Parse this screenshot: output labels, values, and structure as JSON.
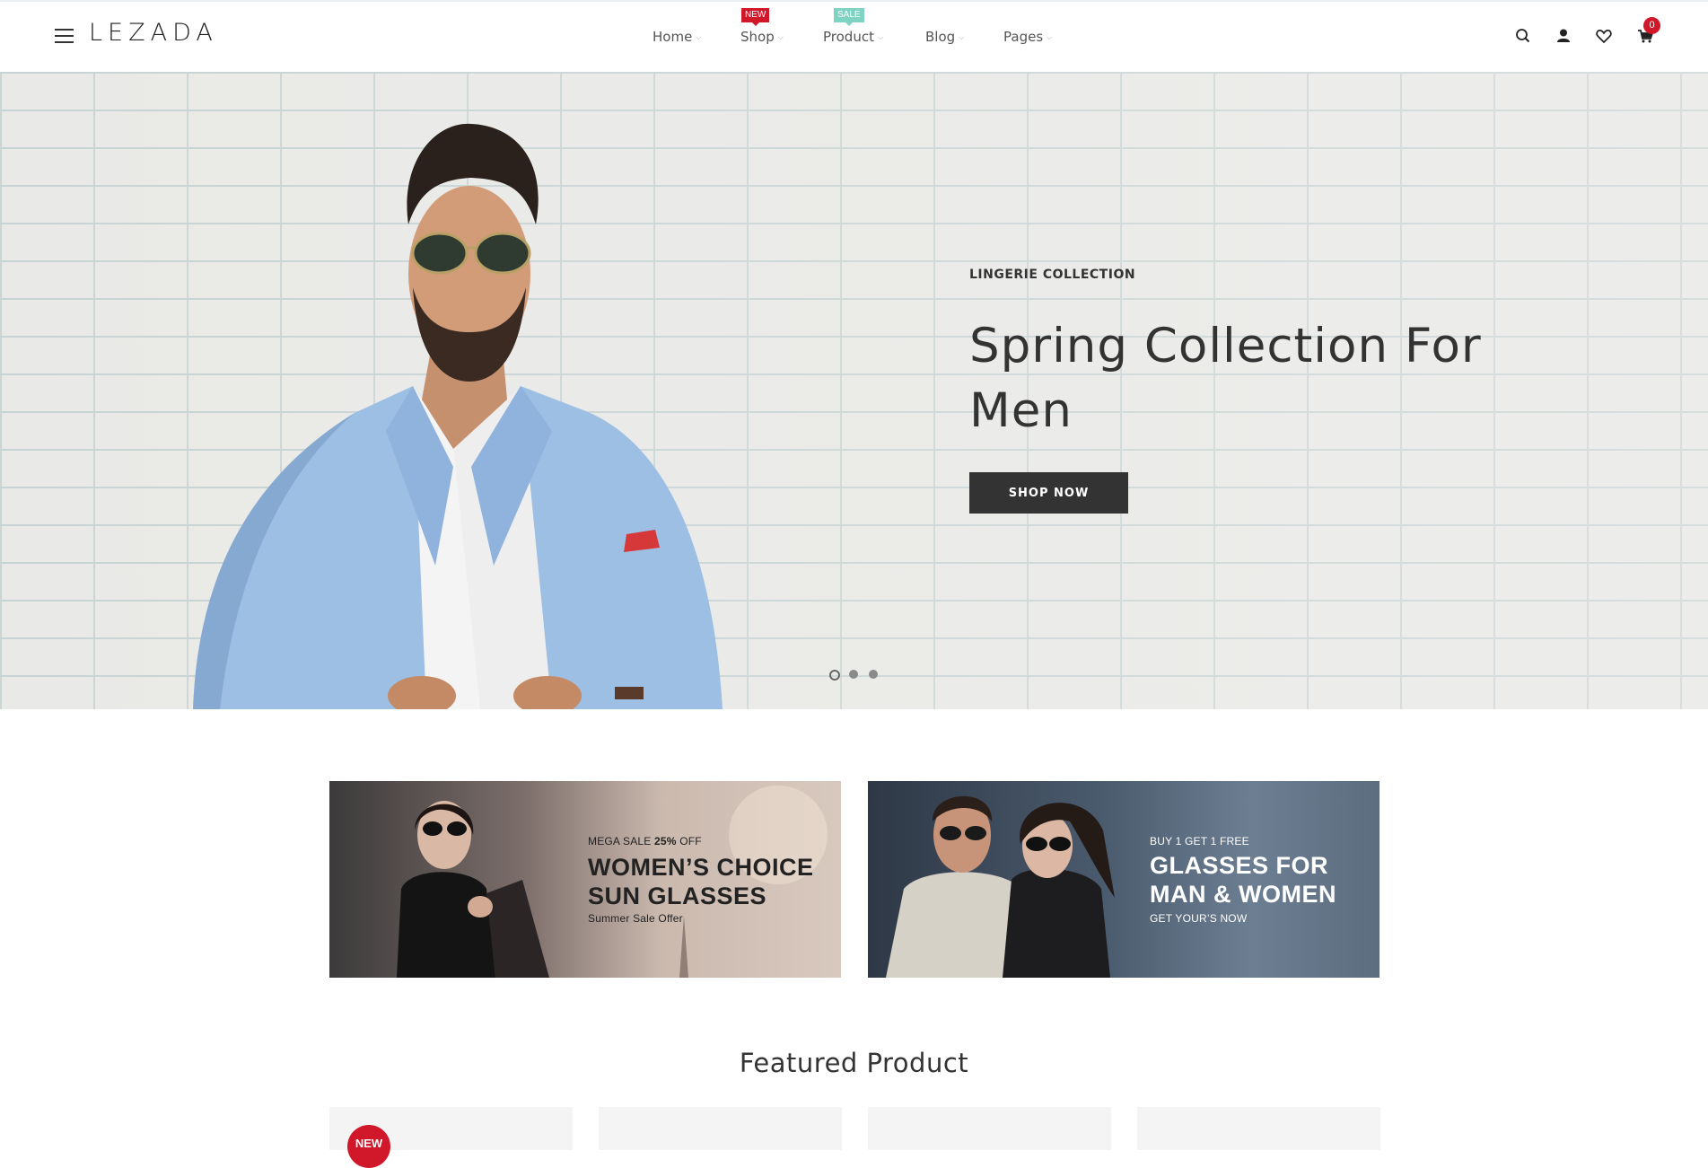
{
  "brand": {
    "logo": "LEZADA"
  },
  "nav": {
    "items": [
      {
        "label": "Home"
      },
      {
        "label": "Shop",
        "badge": "NEW",
        "badge_color": "#d0182a"
      },
      {
        "label": "Product",
        "badge": "SALE",
        "badge_color": "#7fd3c3"
      },
      {
        "label": "Blog"
      },
      {
        "label": "Pages"
      }
    ]
  },
  "header_icons": [
    "menu-icon",
    "search-icon",
    "user-icon",
    "heart-icon",
    "cart-icon"
  ],
  "cart": {
    "count": "0"
  },
  "hero": {
    "subtitle": "LINGERIE COLLECTION",
    "title": "Spring Collection For Men",
    "button": "SHOP NOW",
    "slides": 3,
    "active_slide": 1
  },
  "banners": [
    {
      "sale_prefix": "MEGA SALE",
      "sale_value": "25%",
      "sale_suffix": "OFF",
      "line1": "WOMEN’S CHOICE",
      "line2": "SUN GLASSES",
      "sub": "Summer Sale Offer"
    },
    {
      "top": "BUY 1 GET 1 FREE",
      "line1": "GLASSES FOR",
      "line2": "MAN & WOMEN",
      "sub": "GET YOUR’S NOW"
    }
  ],
  "featured": {
    "title": "Featured Product",
    "badge": "NEW"
  },
  "colors": {
    "accent_red": "#d0182a",
    "sale_teal": "#7fd3c3",
    "dark_button": "#333333"
  }
}
